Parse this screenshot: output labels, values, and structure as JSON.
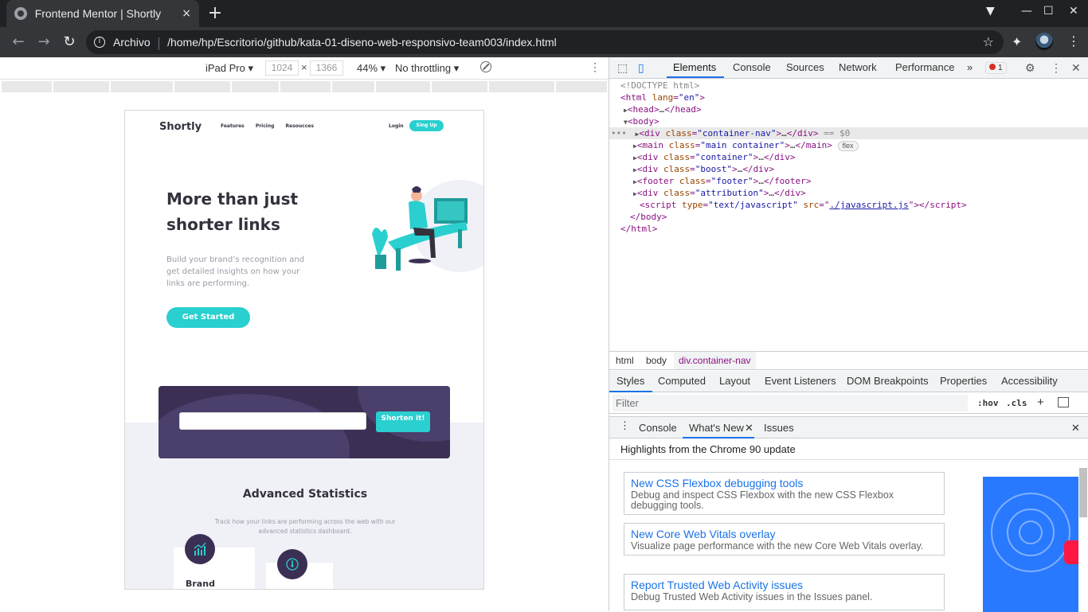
{
  "browser": {
    "tab_title": "Frontend Mentor | Shortly",
    "close_glyph": "×",
    "new_tab_glyph": "+",
    "archivo_label": "Archivo",
    "url": "/home/hp/Escritorio/github/kata-01-diseno-web-responsivo-team003/index.html"
  },
  "device_toolbar": {
    "device": "iPad Pro",
    "width": "1024",
    "height": "1366",
    "times": "×",
    "zoom": "44%",
    "throttling": "No throttling"
  },
  "page": {
    "logo": "Shortly",
    "nav": [
      "Features",
      "Pricing",
      "Resoucces"
    ],
    "login": "Login",
    "signup": "Sing Up",
    "hero_title": "More than just shorter links",
    "hero_desc": "Build your brand’s recognition and get detailed insights on how your links are performing.",
    "cta": "Get Started",
    "shorten_button": "Shorten it!",
    "stats_title": "Advanced Statistics",
    "stats_desc": "Track how your links are performing across the web with our advanced statistics dashboard.",
    "card1_title": "Brand"
  },
  "devtools": {
    "tabs": [
      "Elements",
      "Console",
      "Sources",
      "Network",
      "Performance"
    ],
    "more_tabs": "»",
    "error_count": "1",
    "dom": {
      "doctype": "<!DOCTYPE html>",
      "html_open_tag": "html",
      "html_lang_attr": "lang",
      "html_lang_value": "\"en\"",
      "head": "head",
      "body": "body",
      "rows": [
        {
          "tag": "div",
          "attr": "class",
          "value": "\"container-nav\"",
          "extra": "== $0"
        },
        {
          "tag": "main",
          "attr": "class",
          "value": "\"main container\"",
          "badge": "flex"
        },
        {
          "tag": "div",
          "attr": "class",
          "value": "\"container\""
        },
        {
          "tag": "div",
          "attr": "class",
          "value": "\"boost\""
        },
        {
          "tag": "footer",
          "attr": "class",
          "value": "\"footer\""
        },
        {
          "tag": "div",
          "attr": "class",
          "value": "\"attribution\""
        }
      ],
      "script_type_attr": "type",
      "script_type_value": "\"text/javascript\"",
      "script_src_attr": "src",
      "script_src_value": "./javascript.js",
      "close_body": "</body>",
      "close_html": "</html>"
    },
    "breadcrumbs": [
      "html",
      "body",
      "div.container-nav"
    ],
    "styles_tabs": [
      "Styles",
      "Computed",
      "Layout",
      "Event Listeners",
      "DOM Breakpoints",
      "Properties",
      "Accessibility"
    ],
    "filter_placeholder": "Filter",
    "hov": ":hov",
    "cls": ".cls",
    "drawer_tabs": [
      "Console",
      "What's New",
      "Issues"
    ],
    "whats_new_heading": "Highlights from the Chrome 90 update",
    "whats_new_items": [
      {
        "title": "New CSS Flexbox debugging tools",
        "desc": "Debug and inspect CSS Flexbox with the new CSS Flexbox debugging tools."
      },
      {
        "title": "New Core Web Vitals overlay",
        "desc": "Visualize page performance with the new Core Web Vitals overlay."
      },
      {
        "title": "Report Trusted Web Activity issues",
        "desc": "Debug Trusted Web Activity issues in the Issues panel."
      }
    ]
  }
}
